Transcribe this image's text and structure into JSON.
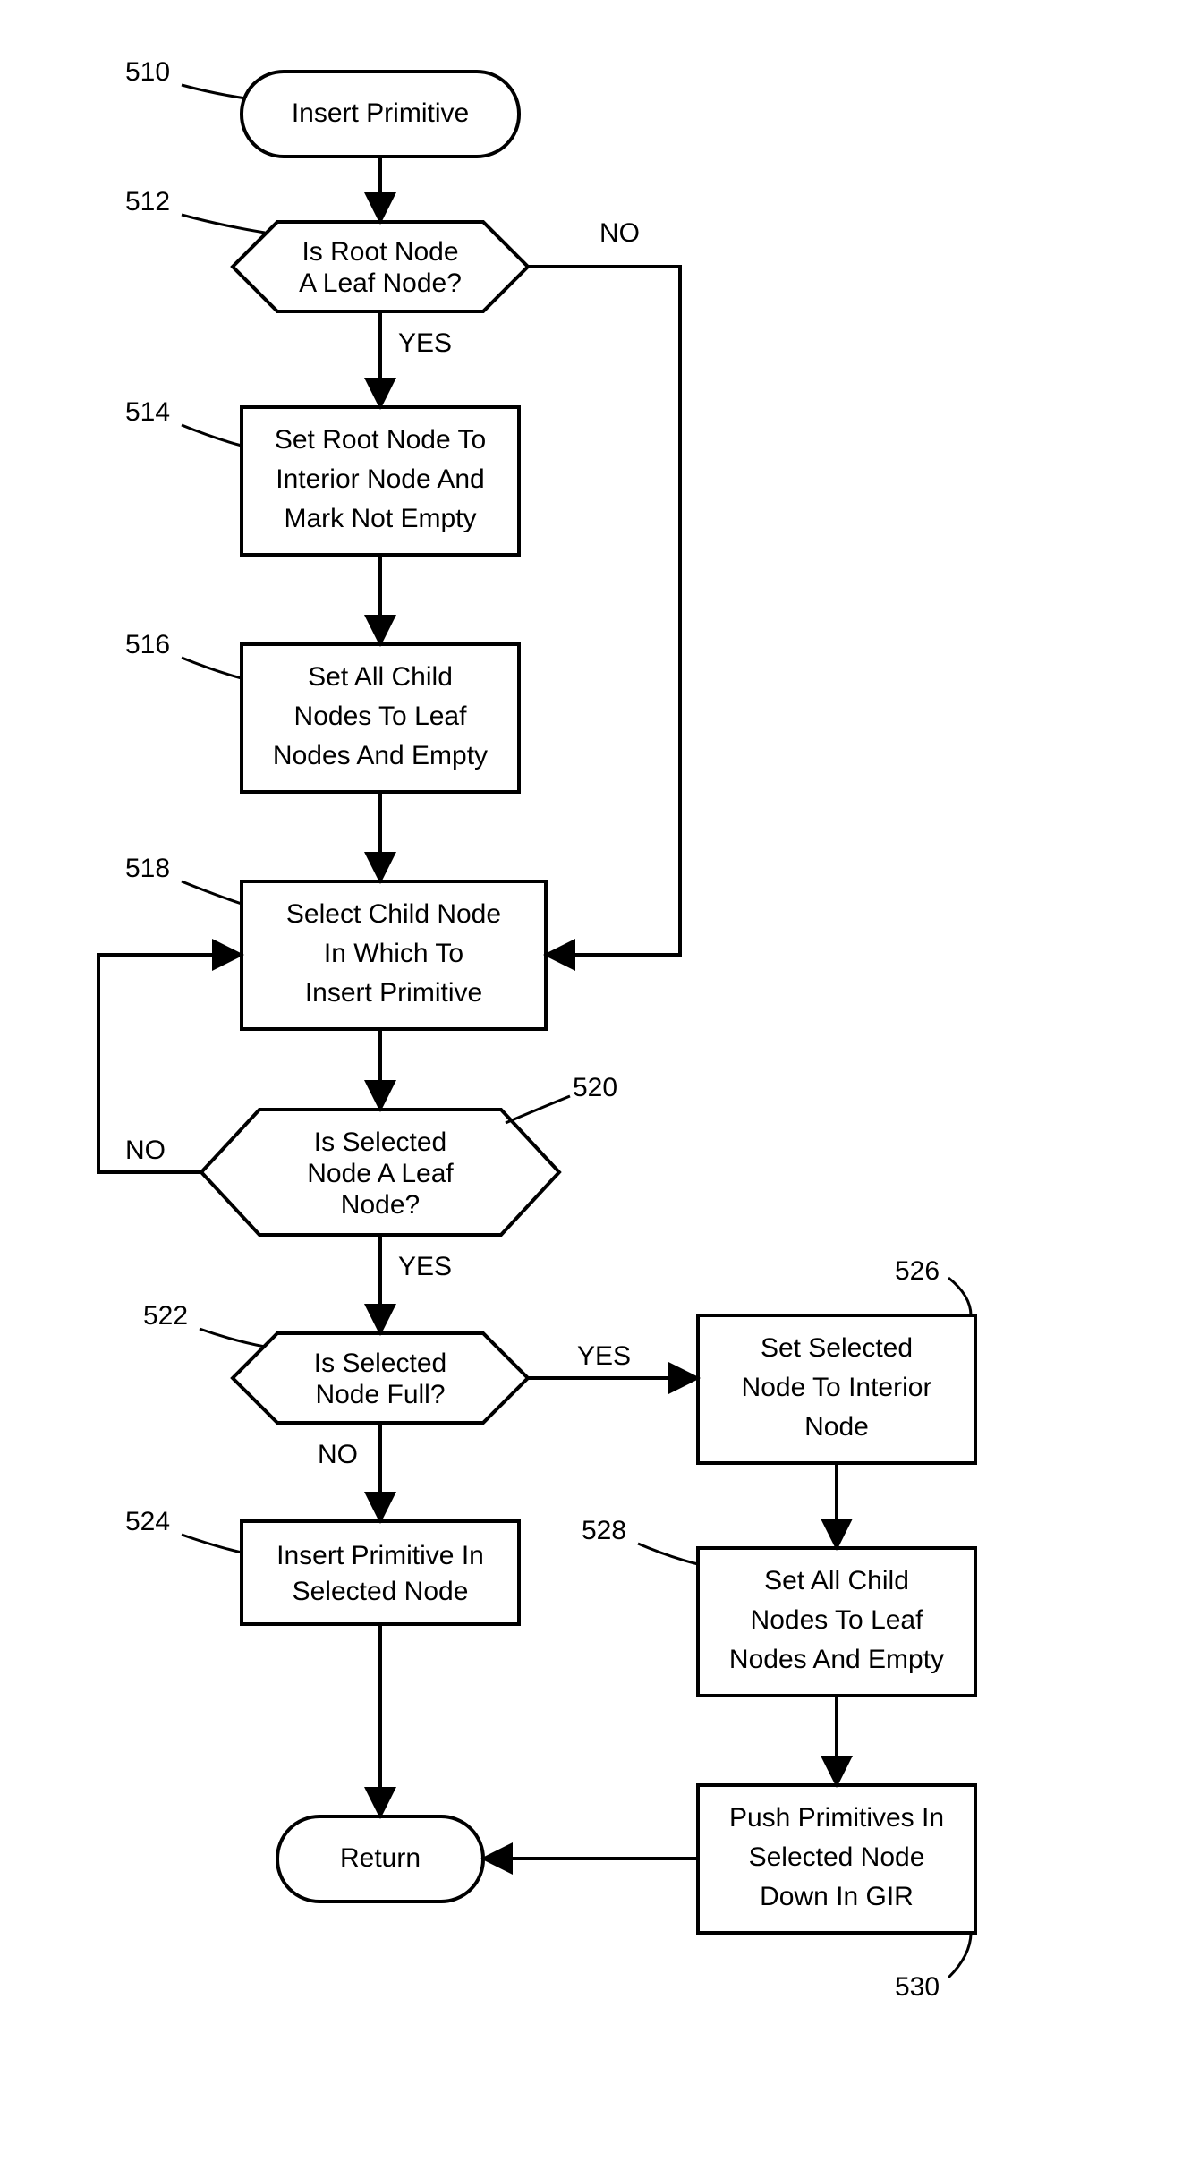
{
  "nodes": {
    "510": {
      "ref": "510",
      "text": [
        "Insert Primitive"
      ]
    },
    "512": {
      "ref": "512",
      "text": [
        "Is Root Node",
        "A Leaf Node?"
      ],
      "yes": "YES",
      "no": "NO"
    },
    "514": {
      "ref": "514",
      "text": [
        "Set Root Node To",
        "Interior Node And",
        "Mark Not Empty"
      ]
    },
    "516": {
      "ref": "516",
      "text": [
        "Set All Child",
        "Nodes To Leaf",
        "Nodes And Empty"
      ]
    },
    "518": {
      "ref": "518",
      "text": [
        "Select Child Node",
        "In Which To",
        "Insert Primitive"
      ]
    },
    "520": {
      "ref": "520",
      "text": [
        "Is Selected",
        "Node  A Leaf",
        "Node?"
      ],
      "yes": "YES",
      "no": "NO"
    },
    "522": {
      "ref": "522",
      "text": [
        "Is Selected",
        "Node  Full?"
      ],
      "yes": "YES",
      "no": "NO"
    },
    "524": {
      "ref": "524",
      "text": [
        "Insert Primitive In",
        "Selected Node"
      ]
    },
    "526": {
      "ref": "526",
      "text": [
        "Set Selected",
        "Node To Interior",
        "Node"
      ]
    },
    "528": {
      "ref": "528",
      "text": [
        "Set All Child",
        "Nodes To Leaf",
        "Nodes And Empty"
      ]
    },
    "530": {
      "ref": "530",
      "text": [
        "Push Primitives In",
        "Selected Node",
        "Down In GIR"
      ]
    },
    "ret": {
      "text": [
        "Return"
      ]
    }
  }
}
